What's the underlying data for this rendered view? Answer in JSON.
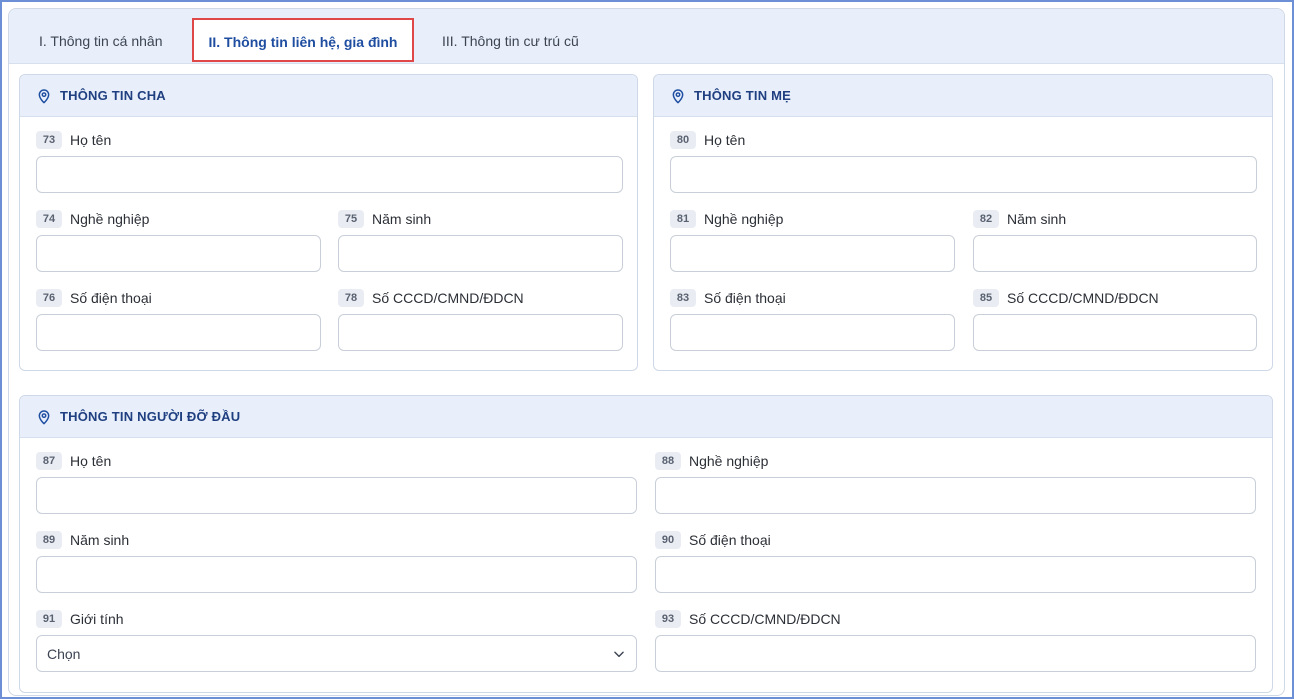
{
  "tabs": [
    {
      "label": "I. Thông tin cá nhân"
    },
    {
      "label": "II. Thông tin liên hệ, gia đình"
    },
    {
      "label": "III. Thông tin cư trú cũ"
    }
  ],
  "father": {
    "title": "THÔNG TIN CHA",
    "fields": [
      {
        "num": "73",
        "label": "Họ tên"
      },
      {
        "num": "74",
        "label": "Nghề nghiệp"
      },
      {
        "num": "75",
        "label": "Năm sinh"
      },
      {
        "num": "76",
        "label": "Số điện thoại"
      },
      {
        "num": "78",
        "label": "Số CCCD/CMND/ĐDCN"
      }
    ]
  },
  "mother": {
    "title": "THÔNG TIN MẸ",
    "fields": [
      {
        "num": "80",
        "label": "Họ tên"
      },
      {
        "num": "81",
        "label": "Nghề nghiệp"
      },
      {
        "num": "82",
        "label": "Năm sinh"
      },
      {
        "num": "83",
        "label": "Số điện thoại"
      },
      {
        "num": "85",
        "label": "Số CCCD/CMND/ĐDCN"
      }
    ]
  },
  "guardian": {
    "title": "THÔNG TIN NGƯỜI ĐỠ ĐẦU",
    "fields": [
      {
        "num": "87",
        "label": "Họ tên"
      },
      {
        "num": "88",
        "label": "Nghề nghiệp"
      },
      {
        "num": "89",
        "label": "Năm sinh"
      },
      {
        "num": "90",
        "label": "Số điện thoại"
      },
      {
        "num": "91",
        "label": "Giới tính",
        "value": "Chọn"
      },
      {
        "num": "93",
        "label": "Số CCCD/CMND/ĐDCN"
      }
    ]
  },
  "colors": {
    "accent": "#1f4ea1",
    "highlight_border": "#e04848",
    "header_bg": "#e8effb"
  },
  "icons": {
    "section": "map-pin-icon",
    "select": "chevron-down-icon"
  }
}
